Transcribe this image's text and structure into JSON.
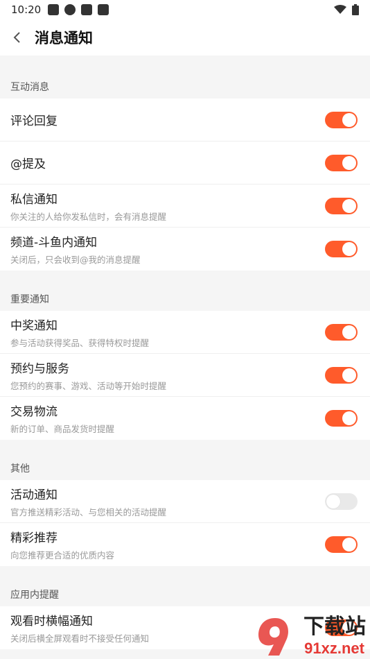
{
  "status": {
    "time": "10:20"
  },
  "header": {
    "title": "消息通知"
  },
  "sections": [
    {
      "title": "互动消息",
      "items": [
        {
          "label": "评论回复",
          "sub": "",
          "on": true
        },
        {
          "label": "@提及",
          "sub": "",
          "on": true
        },
        {
          "label": "私信通知",
          "sub": "你关注的人给你发私信时，会有消息提醒",
          "on": true
        },
        {
          "label": "频道-斗鱼内通知",
          "sub": "关闭后，只会收到@我的消息提醒",
          "on": true
        }
      ]
    },
    {
      "title": "重要通知",
      "items": [
        {
          "label": "中奖通知",
          "sub": "参与活动获得奖品、获得特权时提醒",
          "on": true
        },
        {
          "label": "预约与服务",
          "sub": "您预约的赛事、游戏、活动等开始时提醒",
          "on": true
        },
        {
          "label": "交易物流",
          "sub": "新的订单、商品发货时提醒",
          "on": true
        }
      ]
    },
    {
      "title": "其他",
      "items": [
        {
          "label": "活动通知",
          "sub": "官方推送精彩活动、与您相关的活动提醒",
          "on": false
        },
        {
          "label": "精彩推荐",
          "sub": "向您推荐更合适的优质内容",
          "on": true
        }
      ]
    },
    {
      "title": "应用内提醒",
      "items": [
        {
          "label": "观看时横幅通知",
          "sub": "关闭后横全屏观看时不接受任何通知",
          "on": true
        }
      ]
    }
  ],
  "watermark": {
    "text": "下载站",
    "url": "91xz.net"
  },
  "colors": {
    "accent": "#ff5b2b",
    "off": "#e9e9e9"
  }
}
